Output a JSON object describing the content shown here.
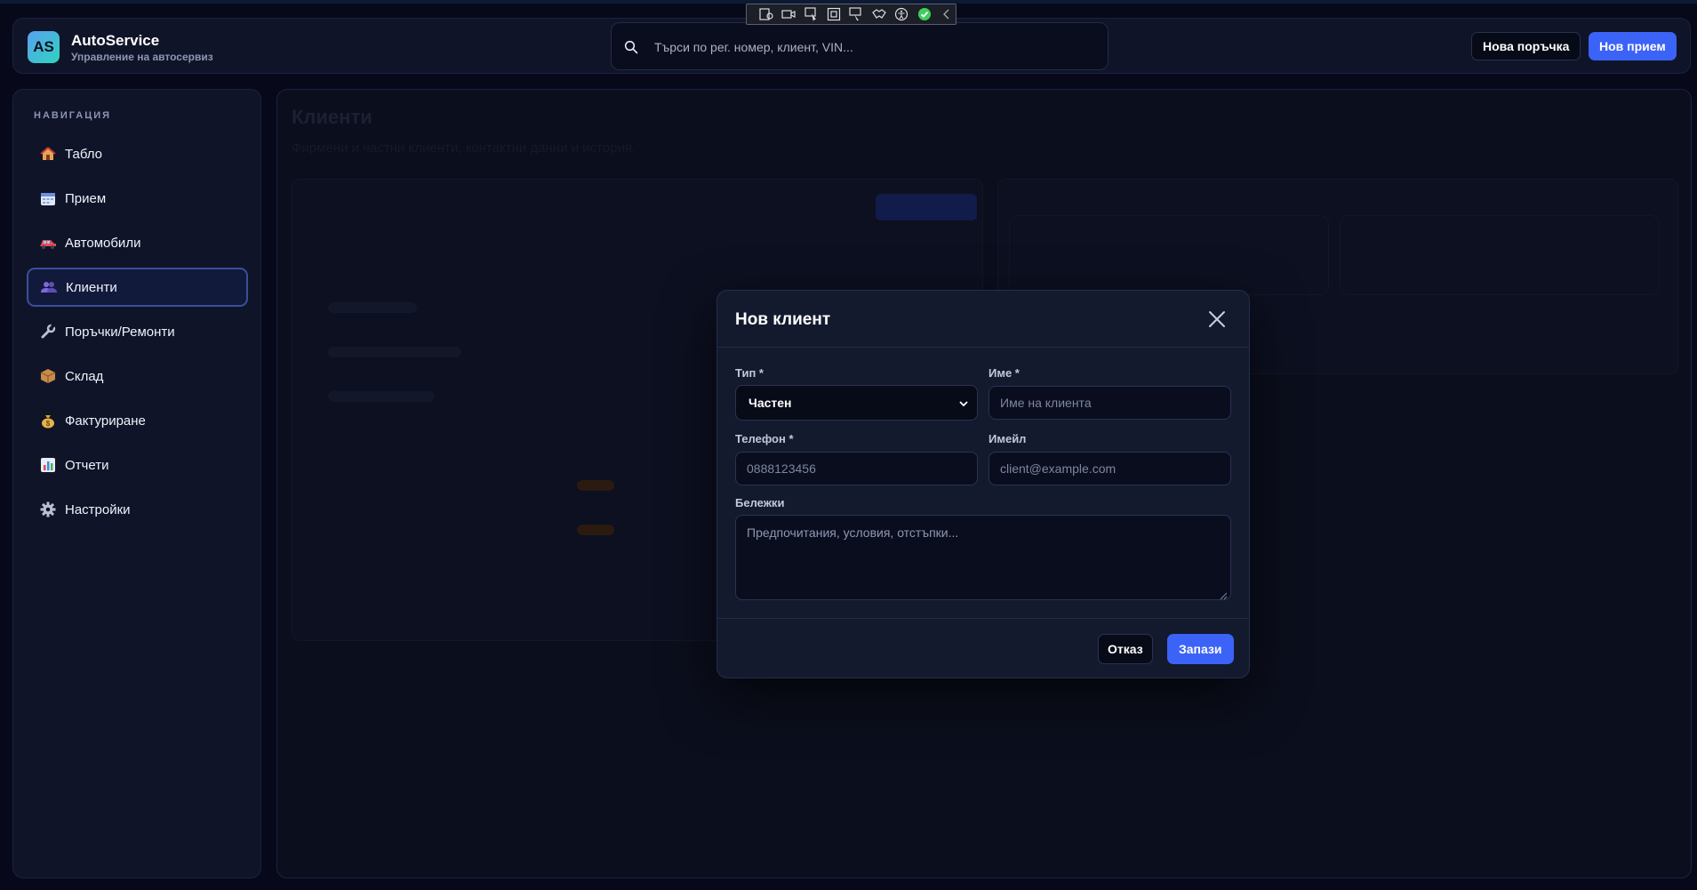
{
  "app": {
    "name": "AutoService",
    "subtitle": "Управление на автосервиз",
    "logo_text": "AS",
    "accent_color": "#3b63f7"
  },
  "header": {
    "search_placeholder": "Търси по рег. номер, клиент, VIN...",
    "new_order_label": "Нова поръчка",
    "new_intake_label": "Нов прием"
  },
  "sidebar": {
    "heading": "НАВИГАЦИЯ",
    "items": [
      {
        "label": "Табло",
        "icon": "house-icon"
      },
      {
        "label": "Прием",
        "icon": "calendar-icon"
      },
      {
        "label": "Автомобили",
        "icon": "car-icon"
      },
      {
        "label": "Клиенти",
        "icon": "users-icon",
        "active": true
      },
      {
        "label": "Поръчки/Ремонти",
        "icon": "wrench-icon"
      },
      {
        "label": "Склад",
        "icon": "package-icon"
      },
      {
        "label": "Фактуриране",
        "icon": "money-bag-icon"
      },
      {
        "label": "Отчети",
        "icon": "bar-chart-icon"
      },
      {
        "label": "Настройки",
        "icon": "gear-icon"
      }
    ]
  },
  "page": {
    "title": "Клиенти",
    "subtitle": "Фирмени и частни клиенти, контактни данни и история."
  },
  "modal": {
    "title": "Нов клиент",
    "type_label": "Тип *",
    "type_value": "Частен",
    "name_label": "Име *",
    "name_placeholder": "Име на клиента",
    "phone_label": "Телефон *",
    "phone_placeholder": "0888123456",
    "email_label": "Имейл",
    "email_placeholder": "client@example.com",
    "notes_label": "Бележки",
    "notes_placeholder": "Предпочитания, условия, отстъпки...",
    "cancel_label": "Отказ",
    "save_label": "Запази"
  }
}
